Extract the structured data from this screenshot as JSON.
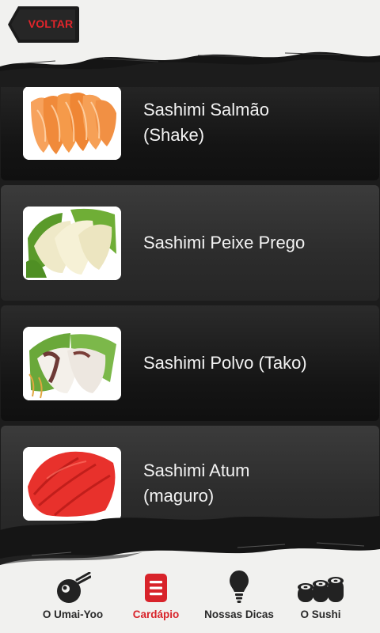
{
  "header": {
    "back_label": "VOLTAR",
    "back_color": "#e2252b"
  },
  "menu_items": [
    {
      "title": "Sashimi Salmão\n(Shake)",
      "image": "salmon-sashimi"
    },
    {
      "title": "Sashimi Peixe Prego",
      "image": "white-fish-sashimi"
    },
    {
      "title": "Sashimi Polvo (Tako)",
      "image": "octopus-sashimi"
    },
    {
      "title": "Sashimi Atum\n(maguro)",
      "image": "tuna-sashimi"
    }
  ],
  "tabs": [
    {
      "label": "O Umai-Yoo",
      "icon": "bowl-chopsticks-icon",
      "active": false
    },
    {
      "label": "Cardápio",
      "icon": "menu-list-icon",
      "active": true
    },
    {
      "label": "Nossas Dicas",
      "icon": "lightbulb-icon",
      "active": false
    },
    {
      "label": "O Sushi",
      "icon": "sushi-rolls-icon",
      "active": false
    }
  ],
  "colors": {
    "accent": "#d8232a",
    "tab_text": "#2a2a2a",
    "paper": "#f1f1ef"
  }
}
